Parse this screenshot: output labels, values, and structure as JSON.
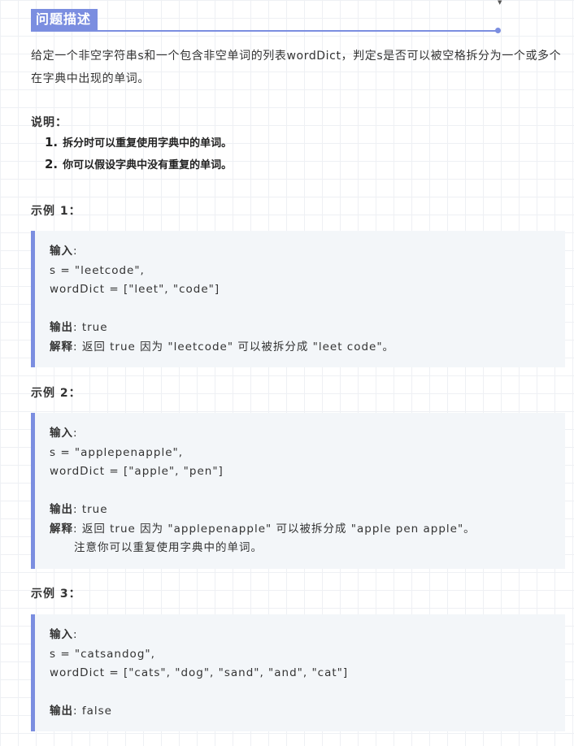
{
  "heading": {
    "title": "问题描述"
  },
  "intro": "给定一个非空字符串s和一个包含非空单词的列表wordDict，判定s是否可以被空格拆分为一个或多个在字典中出现的单词。",
  "notes": {
    "label": "说明：",
    "items": [
      {
        "num": "1.",
        "text": "拆分时可以重复使用字典中的单词。"
      },
      {
        "num": "2.",
        "text": "你可以假设字典中没有重复的单词。"
      }
    ]
  },
  "examples": [
    {
      "label": "示例 1：",
      "input_key": "输入",
      "input_sep": ":",
      "s_line": "s = \"leetcode\",",
      "dict_line": "wordDict = [\"leet\", \"code\"]",
      "output_key": "输出",
      "output_value": ": true",
      "explain_key": "解释",
      "explain_value": ": 返回 true 因为 \"leetcode\" 可以被拆分成 \"leet code\"。"
    },
    {
      "label": "示例 2：",
      "input_key": "输入",
      "input_sep": ":",
      "s_line": "s = \"applepenapple\",",
      "dict_line": "wordDict = [\"apple\", \"pen\"]",
      "output_key": "输出",
      "output_value": ": true",
      "explain_key": "解释",
      "explain_value": ": 返回 true 因为 \"applepenapple\" 可以被拆分成 \"apple pen apple\"。",
      "explain_extra": "注意你可以重复使用字典中的单词。"
    },
    {
      "label": "示例 3：",
      "input_key": "输入",
      "input_sep": ":",
      "s_line": "s = \"catsandog\",",
      "dict_line": "wordDict = [\"cats\", \"dog\", \"sand\", \"and\", \"cat\"]",
      "output_key": "输出",
      "output_value": ": false"
    }
  ],
  "colors": {
    "accent": "#7b8ee0",
    "code_bg": "#f3f6f9",
    "text": "#333333"
  }
}
